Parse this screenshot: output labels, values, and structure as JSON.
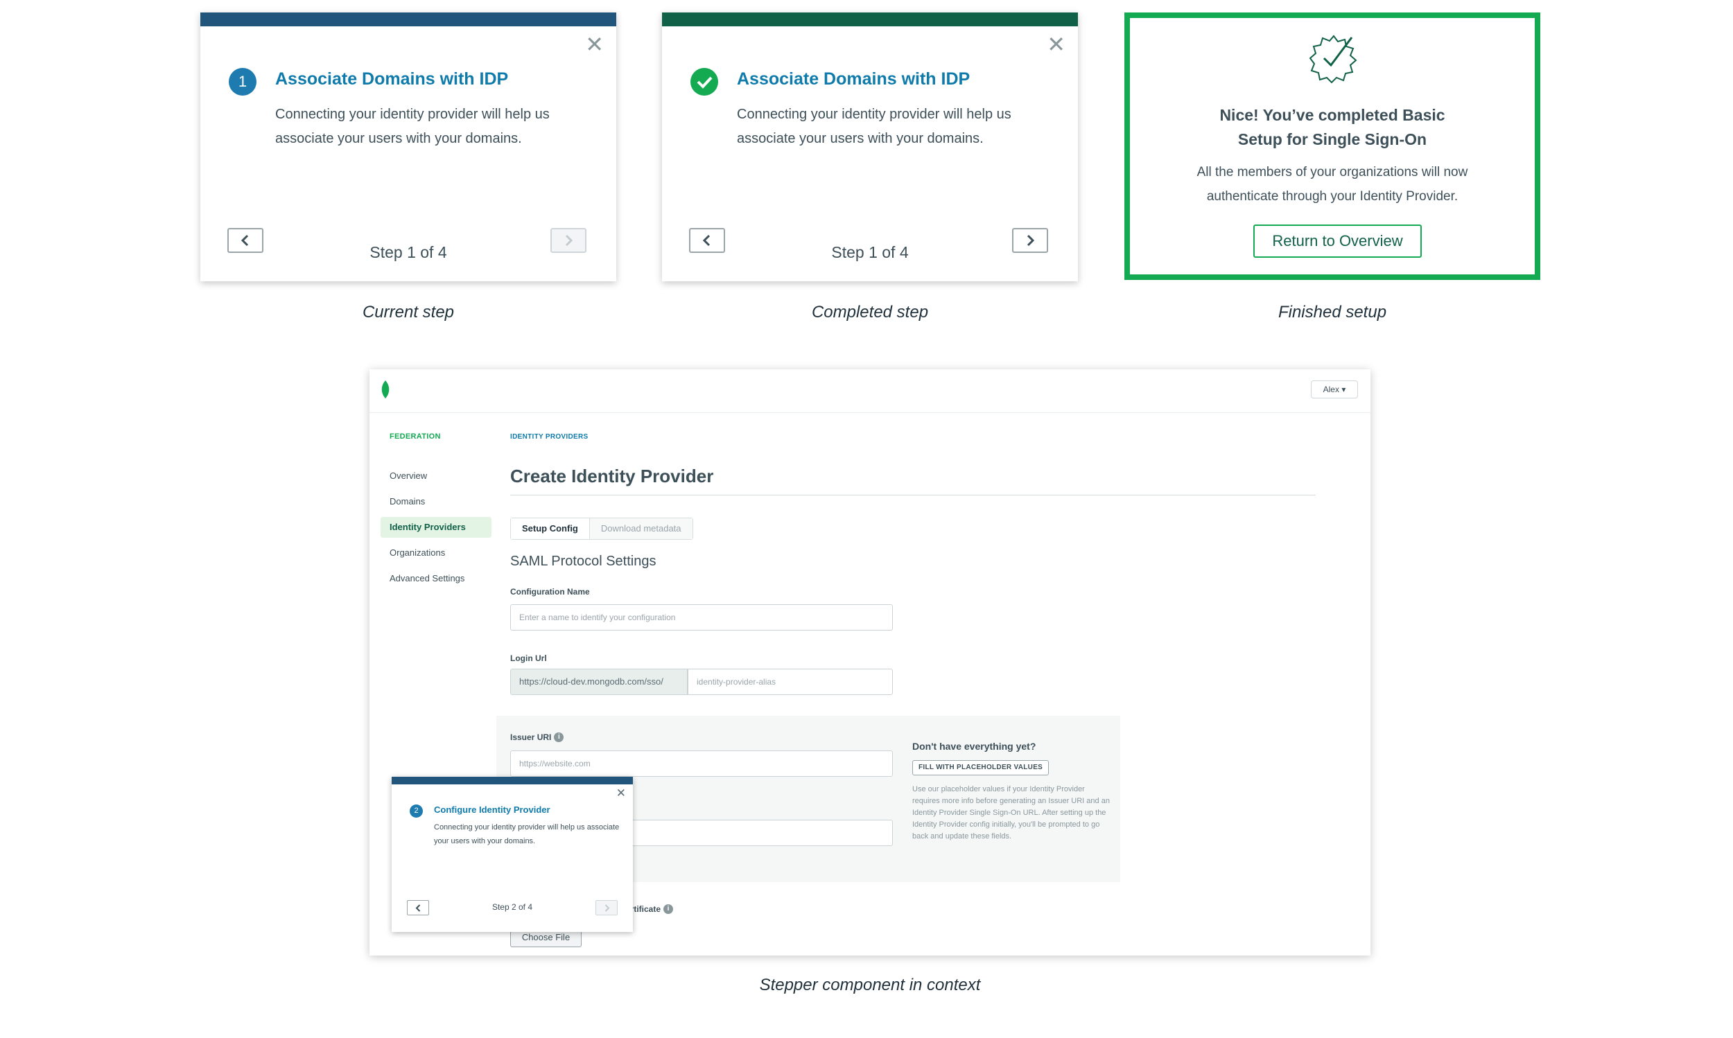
{
  "top_cards": [
    {
      "bar_color": "#21557c",
      "status": "current",
      "step_number": "1",
      "title": "Associate Domains with IDP",
      "body": "Connecting your identity provider will help us associate your users with your domains.",
      "step_label": "Step 1 of 4",
      "caption": "Current step"
    },
    {
      "bar_color": "#116149",
      "status": "completed",
      "title": "Associate Domains with IDP",
      "body": "Connecting your identity provider will help us associate your users with your domains.",
      "step_label": "Step 1 of 4",
      "caption": "Completed step"
    }
  ],
  "finished": {
    "heading_line1": "Nice! You’ve completed Basic",
    "heading_line2": "Setup for Single Sign-On",
    "body_line1": "All the members of your organizations will now",
    "body_line2": "authenticate through your Identity Provider.",
    "button": "Return to Overview",
    "border_color": "#13aa52",
    "caption": "Finished setup"
  },
  "context": {
    "caption": "Stepper component in context",
    "user_menu": "Alex ▾",
    "sidebar": {
      "heading": "FEDERATION",
      "items": [
        "Overview",
        "Domains",
        "Identity Providers",
        "Organizations",
        "Advanced Settings"
      ],
      "active": "Identity Providers"
    },
    "breadcrumb": "IDENTITY PROVIDERS",
    "page_title": "Create Identity Provider",
    "tabs": [
      "Setup Config",
      "Download metadata"
    ],
    "section_title": "SAML Protocol Settings",
    "config_name": {
      "label": "Configuration Name",
      "placeholder": "Enter a name to identify your configuration"
    },
    "login_url": {
      "label": "Login Url",
      "prefix": "https://cloud-dev.mongodb.com/sso/",
      "placeholder": "identity-provider-alias"
    },
    "issuer_uri": {
      "label": "Issuer URI",
      "placeholder": "https://website.com"
    },
    "aside": {
      "heading": "Don't have everything yet?",
      "button": "FILL WITH PLACEHOLDER VALUES",
      "text": "Use our placeholder values if your Identity Provider requires more info before generating an Issuer URI and an Identity Provider Single Sign-On URL. After setting up the Identity Provider config initially, you'll be prompted to go back and update these fields."
    },
    "certificate_label": "ertificate",
    "choose_file": "Choose File",
    "mini_stepper": {
      "step_number": "2",
      "title": "Configure Identity Provider",
      "body": "Connecting your identity provider will help us associate your users with your domains.",
      "step_label": "Step 2 of 4"
    }
  },
  "colors": {
    "accent_blue": "#0f7bab",
    "green": "#13aa52",
    "dark_green": "#116149",
    "navy": "#21557c"
  }
}
